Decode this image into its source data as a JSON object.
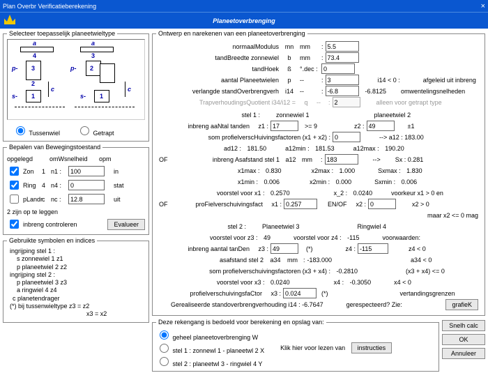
{
  "window": {
    "title": "Plan Overbr Verificatieberekening"
  },
  "header": {
    "title": "Planeetoverbrenging"
  },
  "left": {
    "selector_legend": "Selecteer toepasselijk planeetwieltype",
    "radio_tussenwiel": "Tussenwiel",
    "radio_getrapt": "Getrapt",
    "motion_legend": "Bepalen van Bewegingstoestand",
    "col_opgelegd": "opgelegd",
    "col_omw": "omWsnelheid",
    "col_opm": "opm",
    "zon": "Zon",
    "zon_idx": "1",
    "n1": "n1 :",
    "n1_val": "100",
    "in": "in",
    "ring": "Ring",
    "ring_idx": "4",
    "n4": "n4 :",
    "n4_val": "0",
    "stat": "stat",
    "plandr": "pLandr",
    "plandr_idx": "c",
    "nc": "nc :",
    "nc_val": "12.8",
    "uit": "uit",
    "twee_zijn": "2 zijn op te leggen",
    "inbreng_controleren": "inbreng controleren",
    "evalueer": "Evalueer",
    "symbols_legend": "Gebruikte symbolen en indices",
    "ingr1": "ingrijping stel 1 :",
    "s_zonnewiel": "s  zonnewiel    1    z1",
    "p_planeetwiel": "p  planeetwiel   2    z2",
    "ingr2": "ingrijping stel 2 :",
    "p_planeetwiel2": "p  planeetwiel   3    z3",
    "a_ringwiel": "a  ringwiel        4    z4",
    "c_planetendrager": "c  planetendrager",
    "bij_tussen": "(*) bij tussenwieltype  z3 = z2",
    "x3x2": "x3 = x2"
  },
  "design": {
    "legend": "Ontwerp en narekenen van een planeetoverbrenging",
    "normaalModulus": "normaalModulus",
    "mn": "mn",
    "mm": "mm",
    "mn_val": "5.5",
    "tandBreedte": "tandBreedte zonnewiel",
    "b": "b",
    "b_val": "73.4",
    "tandHoek": "tandHoek",
    "beta": "ß",
    "deg": "°.dec :",
    "beta_val": "0",
    "aantalP": "aantal Planeetwielen",
    "p": "p",
    "p_val": "3",
    "i14lt0": "i14 < 0 :",
    "afgeleid": "afgeleid uit inbreng",
    "verlangde": "verlangde standOverbrengverh",
    "i14": "i14",
    "i14_val": "-6.8",
    "i14_calc": "-6.8125",
    "omw": "omwentelingsnelheden",
    "trap": "TrapverhoudingsQuotient i34/i12  =",
    "q": "q",
    "q_val": "2",
    "alleen": "alleen voor getrapt type",
    "stel1": "stel 1 :",
    "zonnewiel1": "zonnewiel 1",
    "planeetwiel2": "planeetwiel 2",
    "inbreng_tanden": "inbreng aaNtal tanden",
    "z1": "z1 :",
    "z1_val": "17",
    "ge9": ">= 9",
    "z2": "z2 :",
    "z2_val": "49",
    "pm1": "±1",
    "som_prof": "som profielverscHuivingsfactoren  (x1 + x2) :",
    "x1x2_val": "0",
    "a12_arrow": "-->   a12 : 183.00",
    "ad12": "ad12 :",
    "ad12_v": "181.50",
    "a12min": "a12min :",
    "a12min_v": "181.53",
    "a12max": "a12max :",
    "a12max_v": "190.20",
    "OF": "OF",
    "inbreng_asafstand": "inbreng Asafstand stel 1",
    "a12": "a12",
    "a12_val": "183",
    "sx": "Sx : 0.281",
    "x1max": "x1max :",
    "x1max_v": "0.830",
    "x2max": "x2max :",
    "x2max_v": "1.000",
    "sxmax": "Sxmax :",
    "sxmax_v": "1.830",
    "x1min": "x1min :",
    "x1min_v": "0.006",
    "x2min": "x2min :",
    "x2min_v": "0.000",
    "sxmin": "Sxmin :",
    "sxmin_v": "0.006",
    "voorstel_x1": "voorstel voor  x1 :",
    "voorstel_x1_v": "0.2570",
    "x_2": "x_2 :",
    "x_2_v": "0.0240",
    "voorkeur": "voorkeur x1 > 0 en",
    "profiel_fact": "proFielverschuivingsfact",
    "x1": "x1 :",
    "x1_val": "0.257",
    "enof": "EN/OF",
    "x2": "x2 :",
    "x2_val": "0",
    "x2gt0": "x2 > 0",
    "maar": "maar x2 <= 0 mag",
    "stel2": "stel 2 :",
    "planeetwiel3": "Planeetwiel 3",
    "ringwiel4": "Ringwiel 4",
    "voorstel_z3": "voorstel voor  z3 :",
    "voorstel_z3_v": "49",
    "voorstel_z4": "voorstel voor z4 :",
    "voorstel_z4_v": "-115",
    "voorwaarden": "voorwaarden:",
    "inbreng_tanDen": "inbreng aantal tanDen",
    "z3": "z3 :",
    "z3_val": "49",
    "star": "(*)",
    "z4": "z4 :",
    "z4_val": "-115",
    "z4lt0": "z4 < 0",
    "asafstand2": "asafstand stel 2",
    "a34": "a34",
    "a34_v": "-183.000",
    "a34lt0": "a34 < 0",
    "som_prof2": "som profielverschuivingsfactoren  (x3 + x4) :",
    "x3x4_v": "-0.2810",
    "x3x4_le0": "(x3 + x4) <= 0",
    "voorstel_x3": "voorstel voor  x3 :",
    "voorstel_x3_v": "0.0240",
    "x4c": "x4 :",
    "x4c_v": "-0.3050",
    "x4lt0": "x4 < 0",
    "profielCtor": "profielverschuivingsfaCtor",
    "x3": "x3 :",
    "x3_val": "0.024",
    "vertandings": "vertandingsgrenzen",
    "gerealiseerde": "Gerealiseerde standoverbrengverhouding   i14 : -6.7647",
    "gerespecteerd": "gerespecteerd? Zie:",
    "grafiek": "grafieK"
  },
  "bottom": {
    "legend": "Deze rekengang is bedoeld voor berekening en opslag van:",
    "opt_geheel": "geheel planeetoverbrenging          W",
    "opt_stel1": "stel 1 : zonnewl   1 - planeetwl 2  X",
    "opt_stel2": "stel 2 : planeetwl 3 - ringwiel   4  Y",
    "klik": "Klik hier voor lezen van",
    "instructies": "instructies",
    "snelh": "Snelh calc",
    "ok": "OK",
    "annuleer": "Annuleer"
  }
}
